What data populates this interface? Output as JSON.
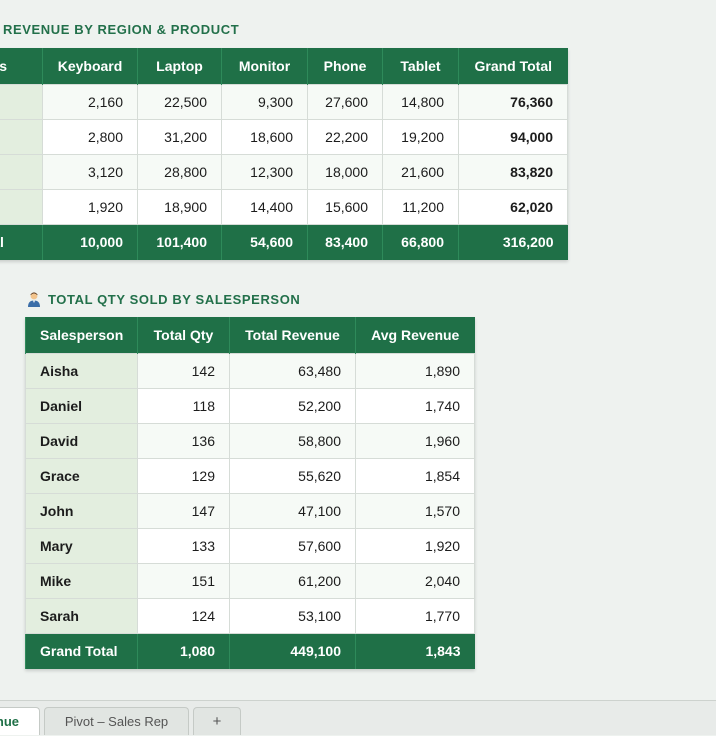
{
  "section1": {
    "title": "REVENUE BY REGION & PRODUCT",
    "headers": [
      "bels",
      "Keyboard",
      "Laptop",
      "Monitor",
      "Phone",
      "Tablet",
      "Grand Total"
    ],
    "rows": [
      [
        "",
        "2,160",
        "22,500",
        "9,300",
        "27,600",
        "14,800",
        "76,360"
      ],
      [
        "",
        "2,800",
        "31,200",
        "18,600",
        "22,200",
        "19,200",
        "94,000"
      ],
      [
        "",
        "3,120",
        "28,800",
        "12,300",
        "18,000",
        "21,600",
        "83,820"
      ],
      [
        "",
        "1,920",
        "18,900",
        "14,400",
        "15,600",
        "11,200",
        "62,020"
      ]
    ],
    "total": [
      "otal",
      "10,000",
      "101,400",
      "54,600",
      "83,400",
      "66,800",
      "316,200"
    ]
  },
  "section2": {
    "icon": "person-icon",
    "title": "TOTAL QTY SOLD BY SALESPERSON",
    "headers": [
      "Salesperson",
      "Total Qty",
      "Total Revenue",
      "Avg Revenue"
    ],
    "rows": [
      [
        "Aisha",
        "142",
        "63,480",
        "1,890"
      ],
      [
        "Daniel",
        "118",
        "52,200",
        "1,740"
      ],
      [
        "David",
        "136",
        "58,800",
        "1,960"
      ],
      [
        "Grace",
        "129",
        "55,620",
        "1,854"
      ],
      [
        "John",
        "147",
        "47,100",
        "1,570"
      ],
      [
        "Mary",
        "133",
        "57,600",
        "1,920"
      ],
      [
        "Mike",
        "151",
        "61,200",
        "2,040"
      ],
      [
        "Sarah",
        "124",
        "53,100",
        "1,770"
      ]
    ],
    "total": [
      "Grand Total",
      "1,080",
      "449,100",
      "1,843"
    ]
  },
  "tabs": {
    "revenue": "nue",
    "salesrep": "Pivot – Sales Rep",
    "add": "+"
  },
  "colors": {
    "header_green": "#1f7047",
    "label_fill": "#e3eedf",
    "title_green": "#22704a"
  }
}
